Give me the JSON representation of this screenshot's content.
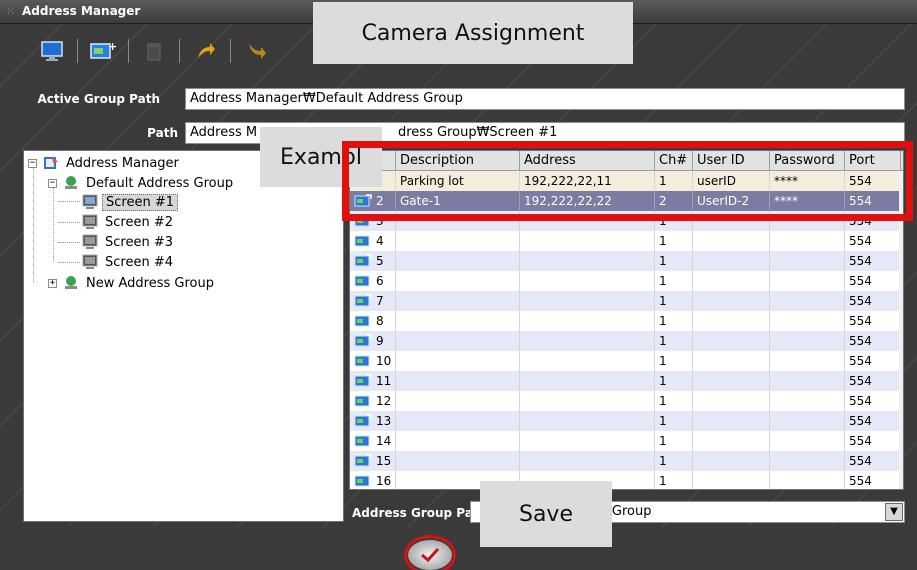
{
  "window": {
    "title": "Address Manager"
  },
  "toolbar": {
    "buttons": [
      {
        "icon": "monitor-icon"
      },
      {
        "icon": "add-camera-icon"
      },
      {
        "icon": "delete-icon"
      },
      {
        "icon": "move-up-icon"
      },
      {
        "icon": "move-down-icon"
      }
    ]
  },
  "annotations": {
    "camera_assignment": "Camera Assignment",
    "example": "Exampl",
    "save": "Save"
  },
  "active_group_path": {
    "label": "Active Group Path",
    "value": "Address Manager₩Default Address Group"
  },
  "path": {
    "label": "Path",
    "value_left": "Address M",
    "value_right": "dress Group₩Screen #1"
  },
  "tree": {
    "root": "Address Manager",
    "group1": "Default Address Group",
    "screens": [
      "Screen #1",
      "Screen #2",
      "Screen #3",
      "Screen #4"
    ],
    "group2": "New Address Group",
    "selected": "Screen #1"
  },
  "table": {
    "columns": [
      "Description",
      "Address",
      "Ch#",
      "User ID",
      "Password",
      "Port"
    ],
    "rows": [
      {
        "no": "",
        "description": "Parking lot",
        "address": "192,222,22,11",
        "ch": "1",
        "user_id": "userID",
        "password": "****",
        "port": "554"
      },
      {
        "no": "2",
        "description": "Gate-1",
        "address": "192,222,22,22",
        "ch": "2",
        "user_id": "UserID-2",
        "password": "****",
        "port": "554"
      },
      {
        "no": "3",
        "description": "",
        "address": "",
        "ch": "1",
        "user_id": "",
        "password": "",
        "port": "554"
      },
      {
        "no": "4",
        "description": "",
        "address": "",
        "ch": "1",
        "user_id": "",
        "password": "",
        "port": "554"
      },
      {
        "no": "5",
        "description": "",
        "address": "",
        "ch": "1",
        "user_id": "",
        "password": "",
        "port": "554"
      },
      {
        "no": "6",
        "description": "",
        "address": "",
        "ch": "1",
        "user_id": "",
        "password": "",
        "port": "554"
      },
      {
        "no": "7",
        "description": "",
        "address": "",
        "ch": "1",
        "user_id": "",
        "password": "",
        "port": "554"
      },
      {
        "no": "8",
        "description": "",
        "address": "",
        "ch": "1",
        "user_id": "",
        "password": "",
        "port": "554"
      },
      {
        "no": "9",
        "description": "",
        "address": "",
        "ch": "1",
        "user_id": "",
        "password": "",
        "port": "554"
      },
      {
        "no": "10",
        "description": "",
        "address": "",
        "ch": "1",
        "user_id": "",
        "password": "",
        "port": "554"
      },
      {
        "no": "11",
        "description": "",
        "address": "",
        "ch": "1",
        "user_id": "",
        "password": "",
        "port": "554"
      },
      {
        "no": "12",
        "description": "",
        "address": "",
        "ch": "1",
        "user_id": "",
        "password": "",
        "port": "554"
      },
      {
        "no": "13",
        "description": "",
        "address": "",
        "ch": "1",
        "user_id": "",
        "password": "",
        "port": "554"
      },
      {
        "no": "14",
        "description": "",
        "address": "",
        "ch": "1",
        "user_id": "",
        "password": "",
        "port": "554"
      },
      {
        "no": "15",
        "description": "",
        "address": "",
        "ch": "1",
        "user_id": "",
        "password": "",
        "port": "554"
      },
      {
        "no": "16",
        "description": "",
        "address": "",
        "ch": "1",
        "user_id": "",
        "password": "",
        "port": "554"
      }
    ],
    "selected_row": "2"
  },
  "address_group_path": {
    "label": "Address Group Pat",
    "value": "s Group"
  },
  "colors": {
    "highlight": "#e0100e",
    "selected_row": "#7a7ca2",
    "row_tint": "#e5e9f7"
  }
}
